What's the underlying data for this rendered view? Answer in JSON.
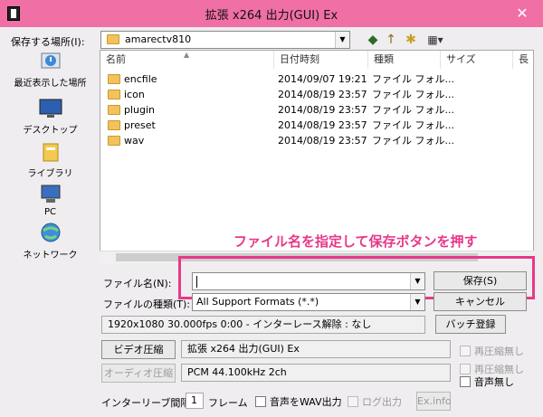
{
  "window": {
    "title": "拡張 x264 出力(GUI) Ex",
    "close_glyph": "✕"
  },
  "location": {
    "label": "保存する場所(I):",
    "value": "amarectv810"
  },
  "toolbar": {
    "back_glyph": "◆",
    "up_glyph": "↑",
    "newfolder_glyph": "✱",
    "view_glyph": "▦▾"
  },
  "places": [
    {
      "label": "最近表示した場所",
      "icon": "recent-places-icon"
    },
    {
      "label": "デスクトップ",
      "icon": "desktop-icon"
    },
    {
      "label": "ライブラリ",
      "icon": "libraries-icon"
    },
    {
      "label": "PC",
      "icon": "pc-icon"
    },
    {
      "label": "ネットワーク",
      "icon": "network-icon"
    }
  ],
  "columns": {
    "name": "名前",
    "date": "日付時刻",
    "type": "種類",
    "size": "サイズ",
    "extra": "長"
  },
  "files": [
    {
      "name": "encfile",
      "date": "2014/09/07 19:21",
      "type": "ファイル フォル..."
    },
    {
      "name": "icon",
      "date": "2014/08/19 23:57",
      "type": "ファイル フォル..."
    },
    {
      "name": "plugin",
      "date": "2014/08/19 23:57",
      "type": "ファイル フォル..."
    },
    {
      "name": "preset",
      "date": "2014/08/19 23:57",
      "type": "ファイル フォル..."
    },
    {
      "name": "wav",
      "date": "2014/08/19 23:57",
      "type": "ファイル フォル..."
    }
  ],
  "annotation": "ファイル名を指定して保存ボタンを押す",
  "filename": {
    "label": "ファイル名(N):",
    "value": ""
  },
  "filetype": {
    "label": "ファイルの種類(T):",
    "value": "All Support Formats (*.*)"
  },
  "buttons": {
    "save": "保存(S)",
    "cancel": "キャンセル",
    "batch": "バッチ登録",
    "video": "ビデオ圧縮",
    "audio": "オーディオ圧縮",
    "exinfo": "Ex.info"
  },
  "info": "1920x1080  30.000fps  0:00  -  インターレース解除 : なし",
  "video_codec": "拡張 x264 出力(GUI) Ex",
  "audio_codec": "PCM 44.100kHz 2ch",
  "checks": {
    "recompress_video": "再圧縮無し",
    "recompress_audio": "再圧縮無し",
    "no_audio": "音声無し",
    "audio_wav": "音声をWAV出力",
    "log": "ログ出力"
  },
  "interleave": {
    "label": "インターリーブ間隔 :",
    "value": "1",
    "unit": "フレーム"
  },
  "colors": {
    "titlebar": "#f06fa5",
    "annotation": "#e8388a"
  }
}
